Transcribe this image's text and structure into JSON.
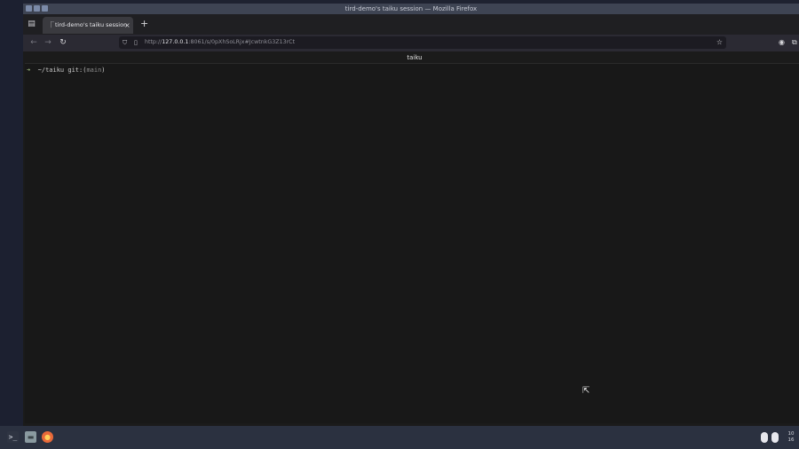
{
  "window": {
    "title": "tird-demo's taiku session — Mozilla Firefox"
  },
  "tabs": [
    {
      "label": "tird-demo's taiku session",
      "close": "×"
    }
  ],
  "new_tab_label": "+",
  "nav": {
    "back_glyph": "←",
    "forward_glyph": "→",
    "reload_glyph": "↻"
  },
  "url": {
    "scheme": "http://",
    "host": "127.0.0.1",
    "rest": ":8061/s/0pXhSoLRjx#JcwtnkG3Z13rCt"
  },
  "terminal": {
    "title": "taiku",
    "prompt_arrow": "➜",
    "prompt_path": "  ~/taiku git:(",
    "prompt_branch": "main",
    "prompt_close": ")"
  },
  "taskbar": {
    "clock_hour": "10",
    "clock_minute": "16"
  },
  "colors": {
    "window_bg": "#1b1b1b",
    "titlebar": "#3e4453",
    "taskbar": "#2b3140",
    "prompt_arrow": "#9ab87a"
  },
  "icons": {
    "tab_list": "tab-list-icon",
    "shield": "shield-icon",
    "page": "page-icon",
    "bookmark": "star-icon",
    "account": "account-icon",
    "extensions": "extensions-icon"
  }
}
